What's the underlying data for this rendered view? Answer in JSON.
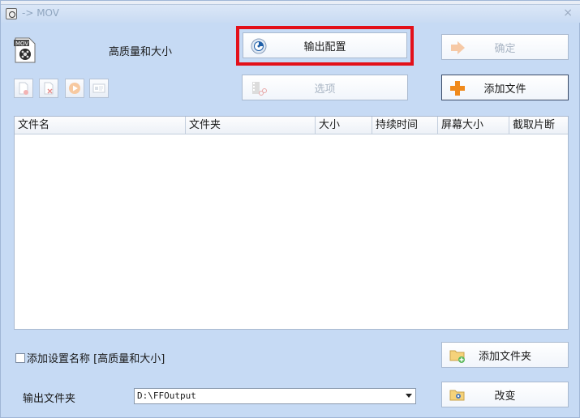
{
  "window": {
    "title": "-> MOV",
    "close_glyph": "×"
  },
  "profile": {
    "name": "高质量和大小",
    "icon": "mov-file-icon"
  },
  "buttons": {
    "output_config": "输出配置",
    "ok": "确定",
    "options": "选项",
    "add_file": "添加文件",
    "add_folder": "添加文件夹",
    "change": "改变"
  },
  "toolbar": {
    "icons": [
      "remove-file-icon",
      "clear-list-icon",
      "play-icon",
      "media-info-icon"
    ]
  },
  "file_list": {
    "columns": [
      "文件名",
      "文件夹",
      "大小",
      "持续时间",
      "屏幕大小",
      "截取片断"
    ],
    "rows": []
  },
  "add_setting_name": {
    "label": "添加设置名称 [高质量和大小]",
    "checked": false
  },
  "output_folder": {
    "label": "输出文件夹",
    "value": "D:\\FFOutput"
  },
  "colors": {
    "highlight": "#e3101a",
    "window_bg": "#c6daf4",
    "accent_orange": "#f08a1c"
  }
}
